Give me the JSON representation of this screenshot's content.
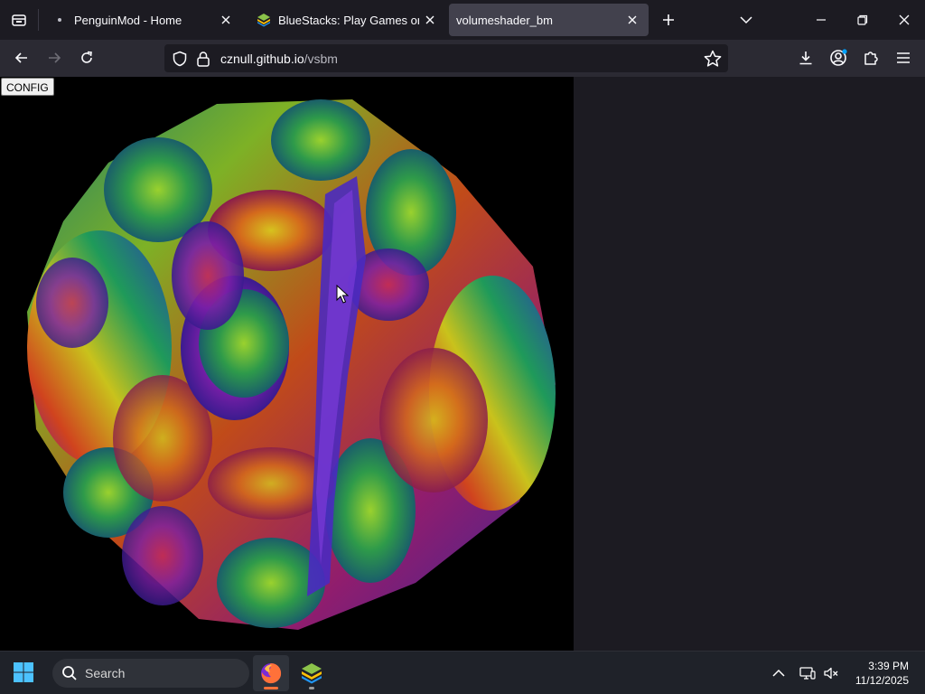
{
  "browser": {
    "tabs": [
      {
        "title": "PenguinMod - Home",
        "active": false
      },
      {
        "title": "BlueStacks: Play Games on PC & Mac",
        "active": false
      },
      {
        "title": "volumeshader_bm",
        "active": true
      }
    ],
    "url_host": "cznull.github.io",
    "url_path": "/vsbm"
  },
  "page": {
    "config_label": "CONFIG"
  },
  "taskbar": {
    "search_label": "Search",
    "time": "3:39 PM",
    "date": "11/12/2025"
  },
  "colors": {
    "accent": "#00a1ff",
    "firefox": "#ff7139"
  }
}
